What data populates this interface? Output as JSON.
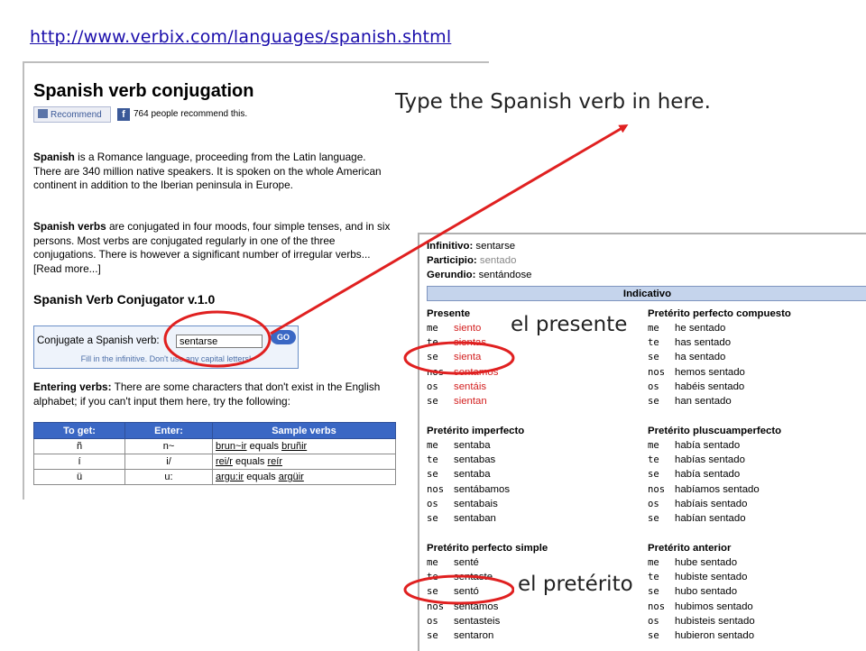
{
  "url": "http://www.verbix.com/languages/spanish.shtml",
  "left_page": {
    "title": "Spanish verb conjugation",
    "recommend_button": "Recommend",
    "fb_letter": "f",
    "recommend_count": "764 people recommend this.",
    "para1": "is a Romance language, proceeding from the Latin language. There are 340 million native speakers. It is spoken on the whole American continent in addition to the Iberian peninsula in Europe.",
    "para1_lead": "Spanish",
    "para2_lead": "Spanish verbs",
    "para2": "are conjugated in four moods, four simple tenses, and in six persons. Most verbs are conjugated regularly in one of the three conjugations. There is however a significant number of irregular verbs... [Read more...]",
    "conjugator_title": "Spanish Verb Conjugator v.1.0",
    "conj_label": "Conjugate a Spanish verb:",
    "conj_value": "sentarse",
    "go_label": "GO",
    "conj_hint": "Fill in the infinitive. Don't use any capital letters!",
    "para3_lead": "Entering verbs:",
    "para3": "There are some characters that don't exist in the English alphabet; if you can't input them here, try the following:",
    "table": {
      "headers": [
        "To get:",
        "Enter:",
        "Sample verbs"
      ],
      "rows": [
        {
          "get": "ñ",
          "enter": "n~",
          "sample_a": "brun~ir",
          "equals": " equals ",
          "sample_b": "bruñir"
        },
        {
          "get": "í",
          "enter": "i/",
          "sample_a": "rei/r",
          "equals": " equals ",
          "sample_b": "reír"
        },
        {
          "get": "ü",
          "enter": "u:",
          "sample_a": "argu:ir",
          "equals": " equals ",
          "sample_b": "argüir"
        }
      ]
    }
  },
  "conj_table": {
    "infinitivo_label": "Infinitivo:",
    "infinitivo": "sentarse",
    "participio_label": "Participio:",
    "participio": "sentado",
    "gerundio_label": "Gerundio:",
    "gerundio": "sentándose",
    "indicativo": "Indicativo",
    "blocks": [
      {
        "title": "Presente",
        "rows": [
          [
            "me",
            "siento"
          ],
          [
            "te",
            "sientas"
          ],
          [
            "se",
            "sienta"
          ],
          [
            "nos",
            "sentamos"
          ],
          [
            "os",
            "sentáis"
          ],
          [
            "se",
            "sientan"
          ]
        ]
      },
      {
        "title": "Pretérito perfecto compuesto",
        "rows": [
          [
            "me",
            "he sentado"
          ],
          [
            "te",
            "has sentado"
          ],
          [
            "se",
            "ha sentado"
          ],
          [
            "nos",
            "hemos sentado"
          ],
          [
            "os",
            "habéis sentado"
          ],
          [
            "se",
            "han sentado"
          ]
        ]
      },
      {
        "title": "Pretérito imperfecto",
        "rows": [
          [
            "me",
            "sentaba"
          ],
          [
            "te",
            "sentabas"
          ],
          [
            "se",
            "sentaba"
          ],
          [
            "nos",
            "sentábamos"
          ],
          [
            "os",
            "sentabais"
          ],
          [
            "se",
            "sentaban"
          ]
        ]
      },
      {
        "title": "Pretérito pluscuamperfecto",
        "rows": [
          [
            "me",
            "había sentado"
          ],
          [
            "te",
            "habías sentado"
          ],
          [
            "se",
            "había sentado"
          ],
          [
            "nos",
            "habíamos sentado"
          ],
          [
            "os",
            "habíais sentado"
          ],
          [
            "se",
            "habían sentado"
          ]
        ]
      },
      {
        "title": "Pretérito perfecto simple",
        "rows": [
          [
            "me",
            "senté"
          ],
          [
            "te",
            "sentaste"
          ],
          [
            "se",
            "sentó"
          ],
          [
            "nos",
            "sentamos"
          ],
          [
            "os",
            "sentasteis"
          ],
          [
            "se",
            "sentaron"
          ]
        ]
      },
      {
        "title": "Pretérito anterior",
        "rows": [
          [
            "me",
            "hube sentado"
          ],
          [
            "te",
            "hubiste sentado"
          ],
          [
            "se",
            "hubo sentado"
          ],
          [
            "nos",
            "hubimos sentado"
          ],
          [
            "os",
            "hubisteis sentado"
          ],
          [
            "se",
            "hubieron sentado"
          ]
        ]
      }
    ],
    "red_block": 0
  },
  "annotations": {
    "type_here": "Type the Spanish verb in here.",
    "presente": "el presente",
    "preterito": "el pretérito"
  },
  "colors": {
    "annotation_red": "#e02020",
    "link_blue": "#1a0dab",
    "header_blue": "#3a67c4"
  }
}
